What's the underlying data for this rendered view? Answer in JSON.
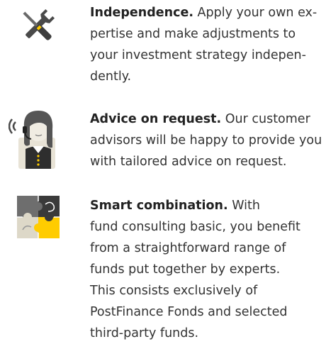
{
  "features": [
    {
      "icon": "tools-icon",
      "heading": "Independence.",
      "lines": [
        " Apply your own ex-",
        "pertise and make adjustments to",
        "your investment strategy indepen-",
        "dently."
      ]
    },
    {
      "icon": "advisor-headset-icon",
      "heading": "Advice on request.",
      "lines": [
        " Our customer",
        "advisors will be happy to provide you",
        "with tailored advice on request."
      ]
    },
    {
      "icon": "puzzle-icon",
      "heading": "Smart combination.",
      "lines": [
        " With",
        "fund consulting basic, you benefit",
        "from a straightforward range of",
        "funds put together by experts.",
        "This consists exclusively of",
        "PostFinance Fonds and selected",
        "third-party funds."
      ]
    }
  ],
  "colors": {
    "accent_yellow": "#FFCC00",
    "icon_dark": "#4a4a4a",
    "text": "#333333"
  }
}
